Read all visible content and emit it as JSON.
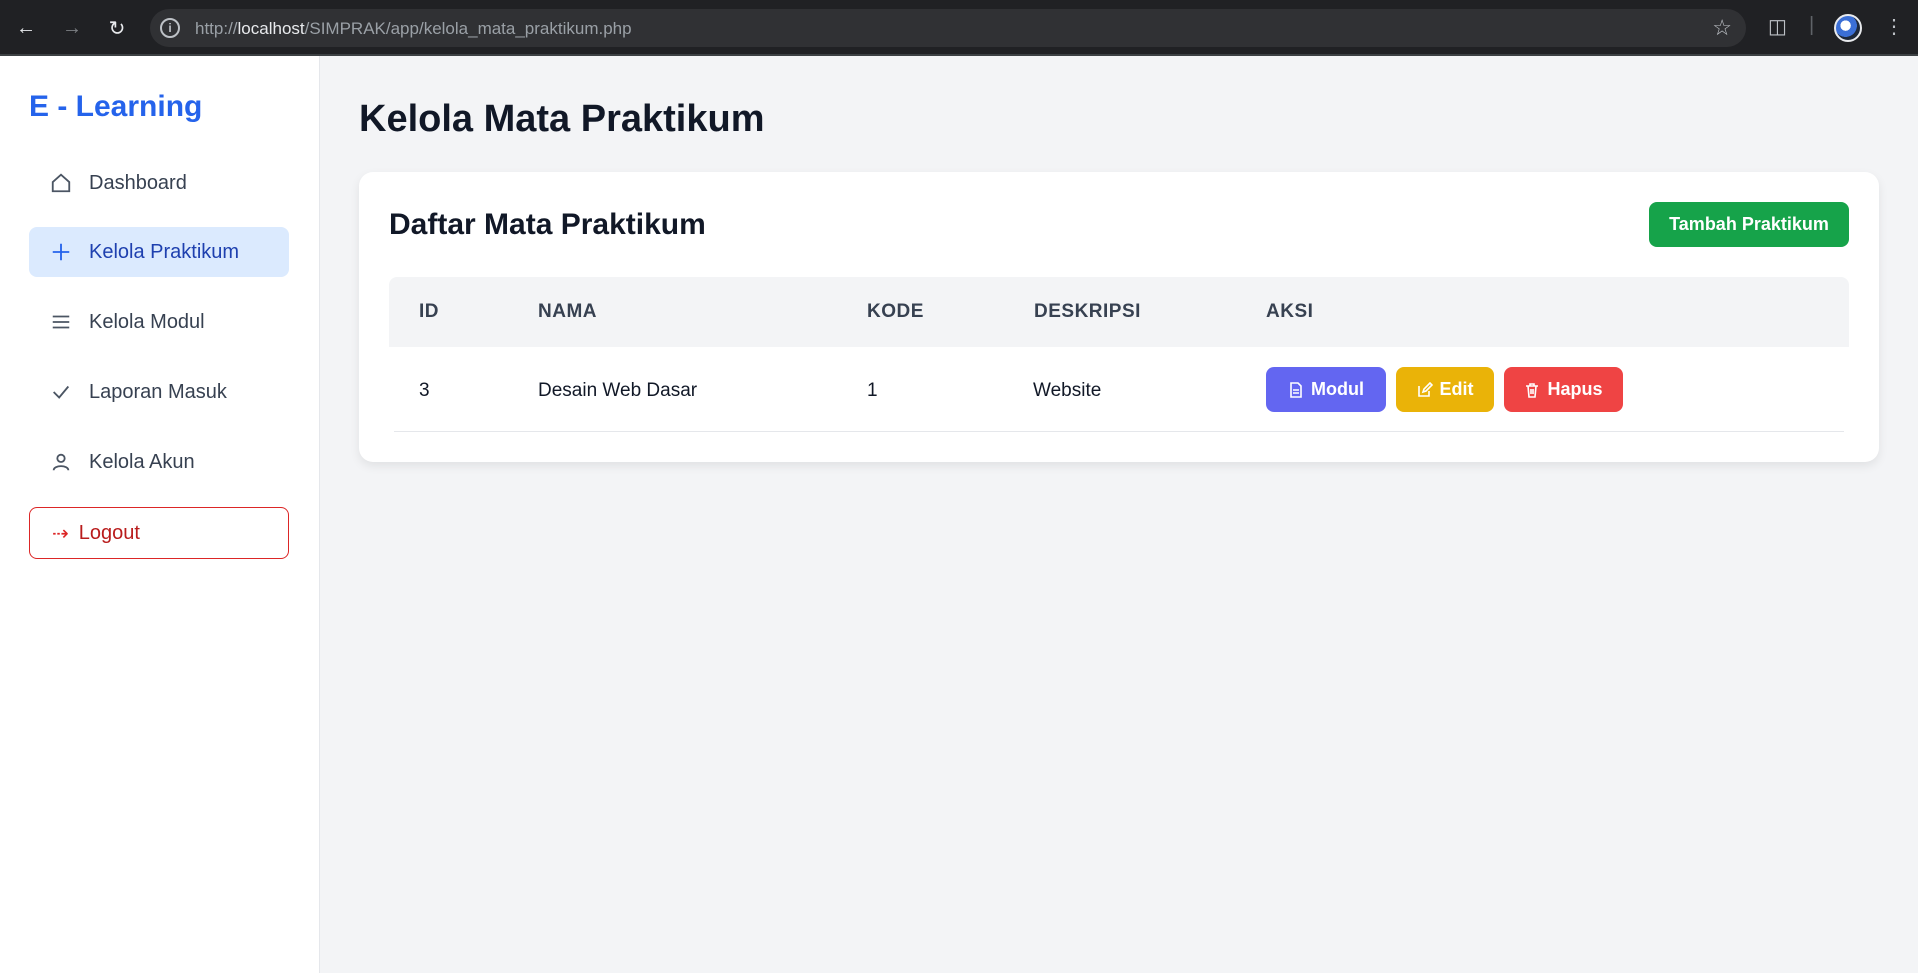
{
  "browser": {
    "url_prefix": "http://",
    "url_host": "localhost",
    "url_path": "/SIMPRAK/app/kelola_mata_praktikum.php"
  },
  "sidebar": {
    "brand": "E - Learning",
    "items": [
      {
        "label": "Dashboard",
        "icon": "home-icon"
      },
      {
        "label": "Kelola Praktikum",
        "icon": "plus-icon",
        "active": true
      },
      {
        "label": "Kelola Modul",
        "icon": "menu-icon"
      },
      {
        "label": "Laporan Masuk",
        "icon": "check-icon"
      },
      {
        "label": "Kelola Akun",
        "icon": "user-icon"
      }
    ],
    "logout": "Logout"
  },
  "main": {
    "title": "Kelola Mata Praktikum",
    "card_title": "Daftar Mata Praktikum",
    "add_button": "Tambah Praktikum",
    "columns": [
      "ID",
      "NAMA",
      "KODE",
      "DESKRIPSI",
      "AKSI"
    ],
    "rows": [
      {
        "id": "3",
        "nama": "Desain Web Dasar",
        "kode": "1",
        "deskripsi": "Website"
      }
    ],
    "actions": {
      "modul": "Modul",
      "edit": "Edit",
      "hapus": "Hapus"
    }
  },
  "colors": {
    "brand": "#2563eb",
    "active_bg": "#dbeafe",
    "success": "#16a34a",
    "modul": "#6366f1",
    "edit": "#eab308",
    "danger": "#ef4444"
  }
}
